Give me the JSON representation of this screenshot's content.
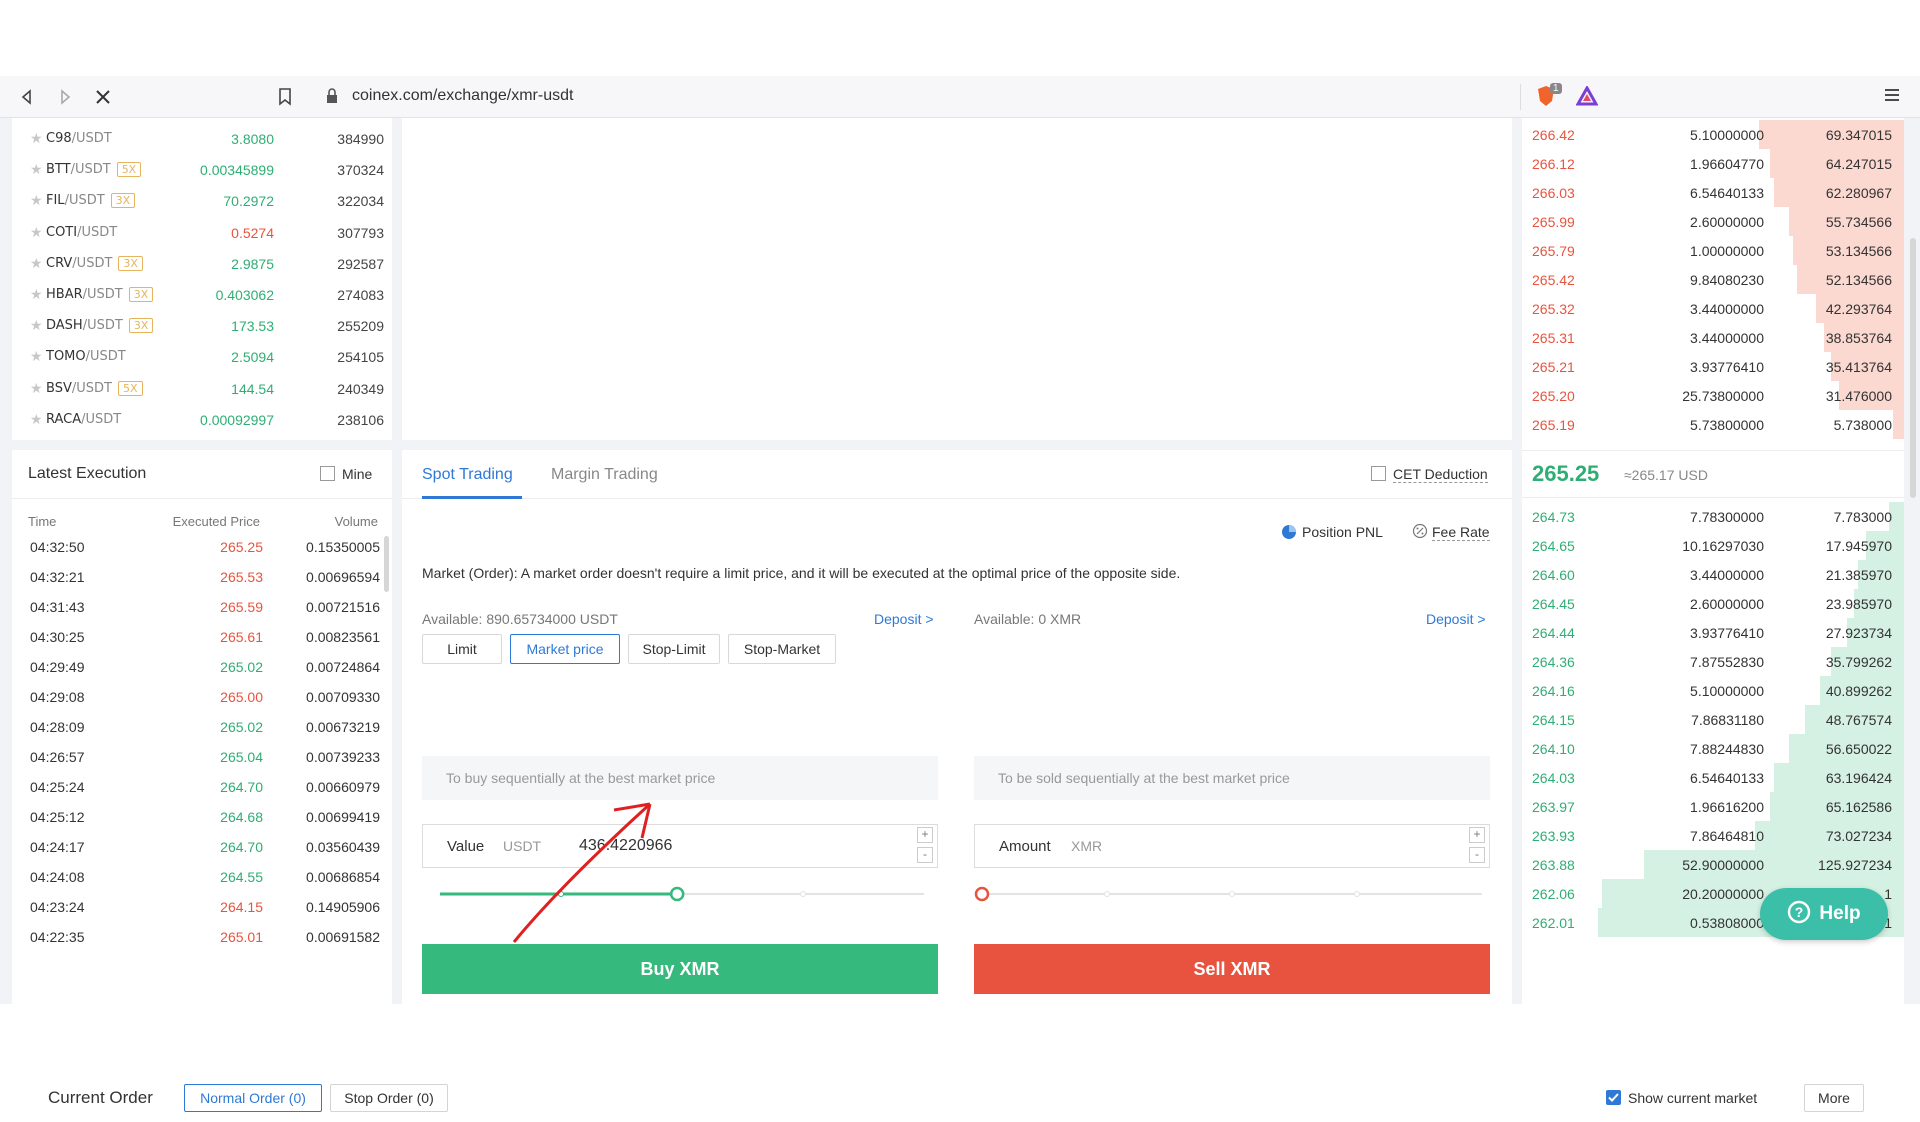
{
  "browser": {
    "url": "coinex.com/exchange/xmr-usdt",
    "brave_badge": "1"
  },
  "colors": {
    "up": "#2fae74",
    "down": "#e8543f",
    "accent": "#2f79d6",
    "buy": "#35b97c",
    "sell": "#e8533f"
  },
  "markets": [
    {
      "base": "C98",
      "quote": "/USDT",
      "lev": "",
      "price": "3.8080",
      "dir": "up",
      "vol": "384990"
    },
    {
      "base": "BTT",
      "quote": "/USDT",
      "lev": "5X",
      "price": "0.00345899",
      "dir": "up",
      "vol": "370324"
    },
    {
      "base": "FIL",
      "quote": "/USDT",
      "lev": "3X",
      "price": "70.2972",
      "dir": "up",
      "vol": "322034"
    },
    {
      "base": "COTI",
      "quote": "/USDT",
      "lev": "",
      "price": "0.5274",
      "dir": "down",
      "vol": "307793"
    },
    {
      "base": "CRV",
      "quote": "/USDT",
      "lev": "3X",
      "price": "2.9875",
      "dir": "up",
      "vol": "292587"
    },
    {
      "base": "HBAR",
      "quote": "/USDT",
      "lev": "3X",
      "price": "0.403062",
      "dir": "up",
      "vol": "274083"
    },
    {
      "base": "DASH",
      "quote": "/USDT",
      "lev": "3X",
      "price": "173.53",
      "dir": "up",
      "vol": "255209"
    },
    {
      "base": "TOMO",
      "quote": "/USDT",
      "lev": "",
      "price": "2.5094",
      "dir": "up",
      "vol": "254105"
    },
    {
      "base": "BSV",
      "quote": "/USDT",
      "lev": "5X",
      "price": "144.54",
      "dir": "up",
      "vol": "240349"
    },
    {
      "base": "RACA",
      "quote": "/USDT",
      "lev": "",
      "price": "0.00092997",
      "dir": "up",
      "vol": "238106"
    }
  ],
  "latest_execution": {
    "title": "Latest Execution",
    "mine_label": "Mine",
    "headers": {
      "time": "Time",
      "price": "Executed Price",
      "volume": "Volume"
    },
    "rows": [
      {
        "time": "04:32:50",
        "price": "265.25",
        "dir": "down",
        "volume": "0.15350005"
      },
      {
        "time": "04:32:21",
        "price": "265.53",
        "dir": "down",
        "volume": "0.00696594"
      },
      {
        "time": "04:31:43",
        "price": "265.59",
        "dir": "down",
        "volume": "0.00721516"
      },
      {
        "time": "04:30:25",
        "price": "265.61",
        "dir": "down",
        "volume": "0.00823561"
      },
      {
        "time": "04:29:49",
        "price": "265.02",
        "dir": "up",
        "volume": "0.00724864"
      },
      {
        "time": "04:29:08",
        "price": "265.00",
        "dir": "down",
        "volume": "0.00709330"
      },
      {
        "time": "04:28:09",
        "price": "265.02",
        "dir": "up",
        "volume": "0.00673219"
      },
      {
        "time": "04:26:57",
        "price": "265.04",
        "dir": "up",
        "volume": "0.00739233"
      },
      {
        "time": "04:25:24",
        "price": "264.70",
        "dir": "up",
        "volume": "0.00660979"
      },
      {
        "time": "04:25:12",
        "price": "264.68",
        "dir": "up",
        "volume": "0.00699419"
      },
      {
        "time": "04:24:17",
        "price": "264.70",
        "dir": "up",
        "volume": "0.03560439"
      },
      {
        "time": "04:24:08",
        "price": "264.55",
        "dir": "up",
        "volume": "0.00686854"
      },
      {
        "time": "04:23:24",
        "price": "264.15",
        "dir": "down",
        "volume": "0.14905906"
      },
      {
        "time": "04:22:35",
        "price": "265.01",
        "dir": "down",
        "volume": "0.00691582"
      }
    ]
  },
  "trading": {
    "tabs": [
      "Spot Trading",
      "Margin Trading"
    ],
    "cet_deduction": "CET Deduction",
    "order_types": [
      "Limit",
      "Market price",
      "Stop-Limit",
      "Stop-Market"
    ],
    "position_pnl": "Position PNL",
    "fee_rate": "Fee Rate",
    "info": "Market (Order): A market order doesn't require a limit price, and it will be executed at the optimal price of the opposite side.",
    "buy": {
      "available": "Available: 890.65734000 USDT",
      "deposit": "Deposit >",
      "placeholder": "To buy sequentially at the best market price",
      "field_label": "Value",
      "field_unit": "USDT",
      "field_value": "436.4220966",
      "slider_fraction": 0.49,
      "button": "Buy XMR"
    },
    "sell": {
      "available": "Available: 0 XMR",
      "deposit": "Deposit >",
      "placeholder": "To be sold sequentially at the best market price",
      "field_label": "Amount",
      "field_unit": "XMR",
      "field_value": "",
      "slider_fraction": 0,
      "button": "Sell XMR"
    }
  },
  "orderbook": {
    "asks": [
      {
        "price": "266.42",
        "amount": "5.10000000",
        "total": "69.347015",
        "depth": 0.38
      },
      {
        "price": "266.12",
        "amount": "1.96604770",
        "total": "64.247015",
        "depth": 0.35
      },
      {
        "price": "266.03",
        "amount": "6.54640133",
        "total": "62.280967",
        "depth": 0.34
      },
      {
        "price": "265.99",
        "amount": "2.60000000",
        "total": "55.734566",
        "depth": 0.3
      },
      {
        "price": "265.79",
        "amount": "1.00000000",
        "total": "53.134566",
        "depth": 0.29
      },
      {
        "price": "265.42",
        "amount": "9.84080230",
        "total": "52.134566",
        "depth": 0.28
      },
      {
        "price": "265.32",
        "amount": "3.44000000",
        "total": "42.293764",
        "depth": 0.23
      },
      {
        "price": "265.31",
        "amount": "3.44000000",
        "total": "38.853764",
        "depth": 0.21
      },
      {
        "price": "265.21",
        "amount": "3.93776410",
        "total": "35.413764",
        "depth": 0.19
      },
      {
        "price": "265.20",
        "amount": "25.73800000",
        "total": "31.476000",
        "depth": 0.17
      },
      {
        "price": "265.19",
        "amount": "5.73800000",
        "total": "5.738000",
        "depth": 0.03
      }
    ],
    "last_price": "265.25",
    "last_usd": "≈265.17 USD",
    "bids": [
      {
        "price": "264.73",
        "amount": "7.78300000",
        "total": "7.783000",
        "depth": 0.04
      },
      {
        "price": "264.65",
        "amount": "10.16297030",
        "total": "17.945970",
        "depth": 0.1
      },
      {
        "price": "264.60",
        "amount": "3.44000000",
        "total": "21.385970",
        "depth": 0.12
      },
      {
        "price": "264.45",
        "amount": "2.60000000",
        "total": "23.985970",
        "depth": 0.13
      },
      {
        "price": "264.44",
        "amount": "3.93776410",
        "total": "27.923734",
        "depth": 0.15
      },
      {
        "price": "264.36",
        "amount": "7.87552830",
        "total": "35.799262",
        "depth": 0.19
      },
      {
        "price": "264.16",
        "amount": "5.10000000",
        "total": "40.899262",
        "depth": 0.22
      },
      {
        "price": "264.15",
        "amount": "7.86831180",
        "total": "48.767574",
        "depth": 0.26
      },
      {
        "price": "264.10",
        "amount": "7.88244830",
        "total": "56.650022",
        "depth": 0.3
      },
      {
        "price": "264.03",
        "amount": "6.54640133",
        "total": "63.196424",
        "depth": 0.34
      },
      {
        "price": "263.97",
        "amount": "1.96616200",
        "total": "65.162586",
        "depth": 0.35
      },
      {
        "price": "263.93",
        "amount": "7.86464810",
        "total": "73.027234",
        "depth": 0.39
      },
      {
        "price": "263.88",
        "amount": "52.90000000",
        "total": "125.927234",
        "depth": 0.68
      },
      {
        "price": "262.06",
        "amount": "20.20000000",
        "total": "1",
        "depth": 0.79
      },
      {
        "price": "262.01",
        "amount": "0.53808000",
        "total": "1",
        "depth": 0.8
      }
    ]
  },
  "footer": {
    "current_order": "Current Order",
    "normal_order": "Normal Order (0)",
    "stop_order": "Stop Order (0)",
    "show_current_market": "Show current market",
    "more": "More"
  },
  "help_label": "Help"
}
